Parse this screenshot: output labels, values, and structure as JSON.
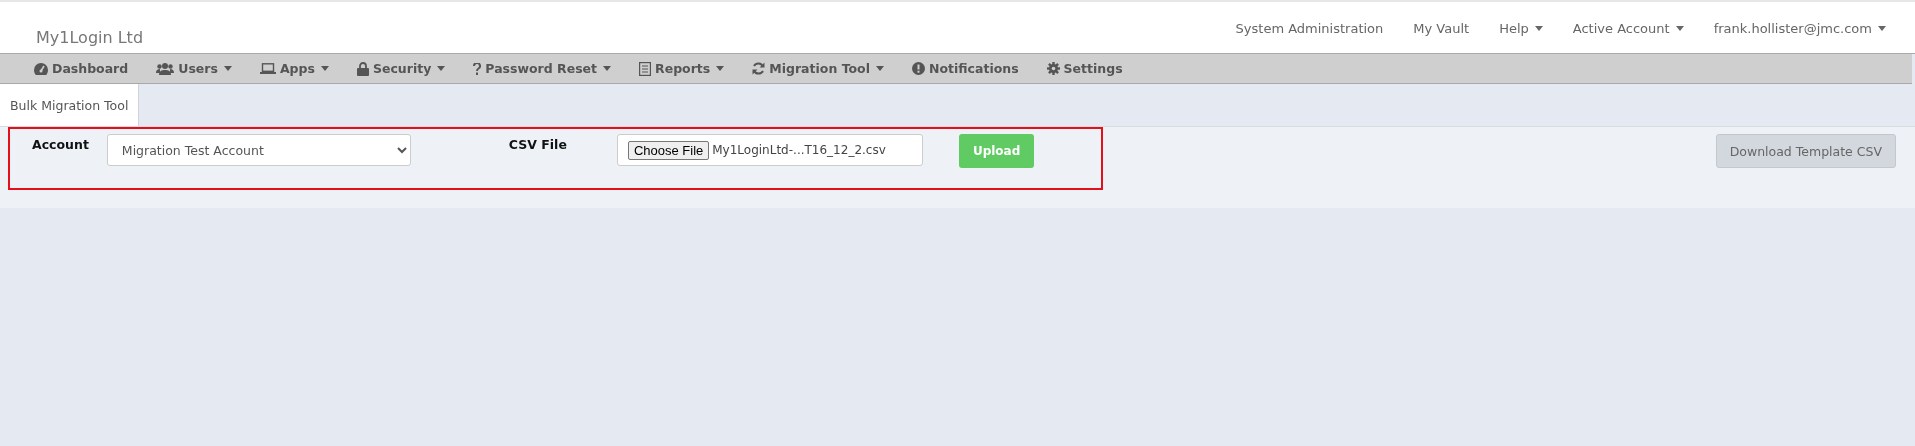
{
  "brand": "My1Login Ltd",
  "top_links": [
    {
      "label": "System Administration",
      "dropdown": false
    },
    {
      "label": "My Vault",
      "dropdown": false
    },
    {
      "label": "Help",
      "dropdown": true
    },
    {
      "label": "Active Account",
      "dropdown": true
    },
    {
      "label": "frank.hollister@jmc.com",
      "dropdown": true
    }
  ],
  "nav": [
    {
      "label": "Dashboard",
      "kind": "dashboard",
      "dropdown": false
    },
    {
      "label": "Users",
      "kind": "users",
      "dropdown": true
    },
    {
      "label": "Apps",
      "kind": "laptop",
      "dropdown": true
    },
    {
      "label": "Security",
      "kind": "lock",
      "dropdown": true
    },
    {
      "label": "Password Reset",
      "kind": "question",
      "dropdown": true
    },
    {
      "label": "Reports",
      "kind": "list",
      "dropdown": true
    },
    {
      "label": "Migration Tool",
      "kind": "refresh",
      "dropdown": true
    },
    {
      "label": "Notifications",
      "kind": "exclamation",
      "dropdown": false
    },
    {
      "label": "Settings",
      "kind": "gear",
      "dropdown": false
    }
  ],
  "tabs": [
    {
      "label": "Bulk Migration Tool",
      "selected": true
    }
  ],
  "form": {
    "account_label": "Account",
    "account_value": "Migration Test Account",
    "csv_label": "CSV File",
    "choose_button": "Choose File",
    "file_name": "My1LoginLtd-...T16_12_2.csv",
    "upload_button": "Upload",
    "highlighted": true
  },
  "download_button": "Download Template CSV"
}
